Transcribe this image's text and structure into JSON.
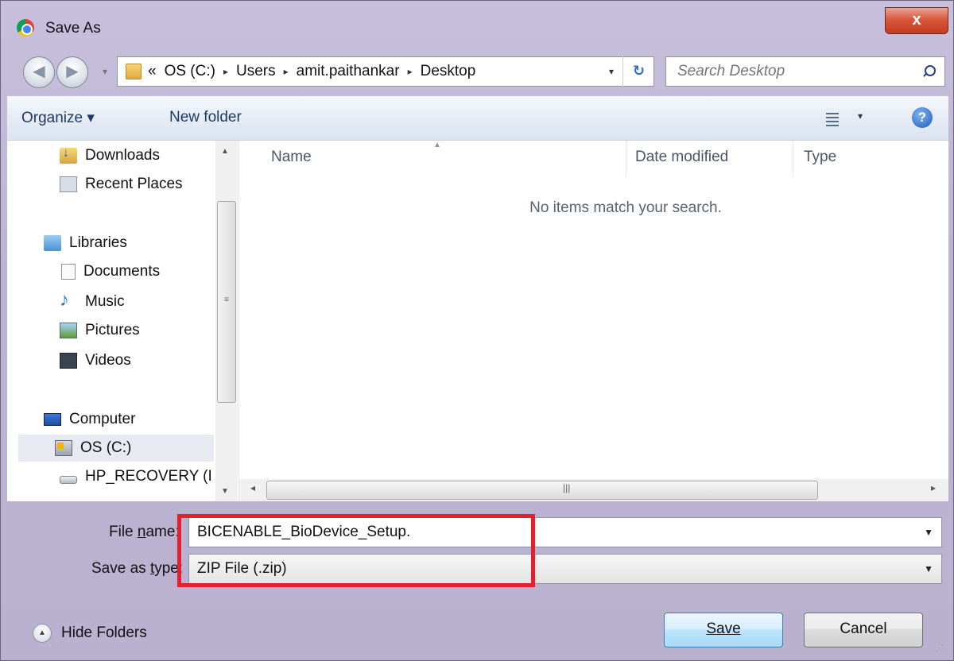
{
  "window": {
    "title": "Save As",
    "close_label": "x"
  },
  "address": {
    "overflow": "«",
    "crumbs": [
      "OS (C:)",
      "Users",
      "amit.paithankar",
      "Desktop"
    ],
    "separator": "▸",
    "dropdown": "▾",
    "refresh": "↻"
  },
  "search": {
    "placeholder": "Search Desktop"
  },
  "toolbar": {
    "organize_label": "Organize ▾",
    "new_folder_label": "New folder",
    "view_dropdown": "▾",
    "help_label": "?"
  },
  "sidebar": {
    "items": [
      {
        "label": "Downloads"
      },
      {
        "label": "Recent Places"
      },
      {
        "label": "Libraries"
      },
      {
        "label": "Documents"
      },
      {
        "label": "Music"
      },
      {
        "label": "Pictures"
      },
      {
        "label": "Videos"
      },
      {
        "label": "Computer"
      },
      {
        "label": "OS (C:)"
      },
      {
        "label": "HP_RECOVERY (I"
      }
    ]
  },
  "content": {
    "columns": [
      "Name",
      "Date modified",
      "Type"
    ],
    "empty_message": "No items match your search."
  },
  "form": {
    "file_name_label_pre": "File ",
    "file_name_label_u": "n",
    "file_name_label_post": "ame:",
    "file_name_value": "BICENABLE_BioDevice_Setup.",
    "save_type_label_pre": "Save as ",
    "save_type_label_u": "t",
    "save_type_label_post": "ype:",
    "save_type_value": "ZIP File (.zip)",
    "highlight_color": "#e3202e"
  },
  "footer": {
    "hide_folders_label": "Hide Folders",
    "save_label": "Save",
    "cancel_label": "Cancel"
  }
}
